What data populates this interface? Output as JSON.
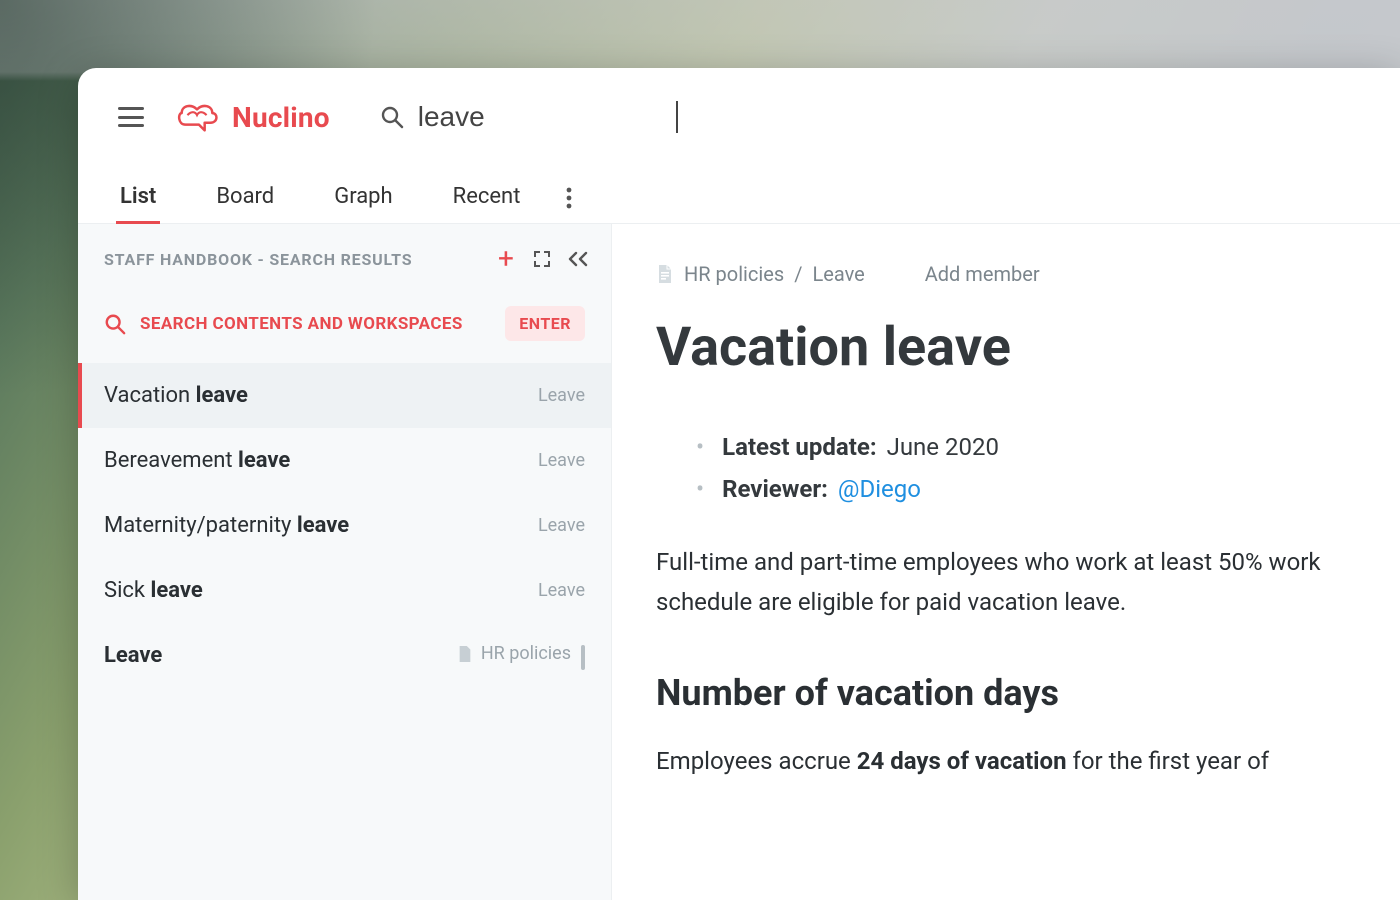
{
  "brand": {
    "name": "Nuclino"
  },
  "search": {
    "value": "leave"
  },
  "tabs": [
    "List",
    "Board",
    "Graph",
    "Recent"
  ],
  "active_tab": 0,
  "sidebar": {
    "title": "STAFF HANDBOOK - SEARCH RESULTS",
    "search_all_label": "SEARCH CONTENTS AND WORKSPACES",
    "enter_label": "ENTER",
    "results": [
      {
        "pre": "Vacation ",
        "match": "leave",
        "tag": "Leave",
        "selected": true
      },
      {
        "pre": "Bereavement ",
        "match": "leave",
        "tag": "Leave"
      },
      {
        "pre": "Maternity/paternity ",
        "match": "leave",
        "tag": "Leave"
      },
      {
        "pre": "Sick ",
        "match": "leave",
        "tag": "Leave"
      },
      {
        "pre": "",
        "match": "Leave",
        "tag_folder": "HR policies",
        "is_folder": true
      }
    ]
  },
  "doc": {
    "breadcrumbs": [
      "HR policies",
      "Leave"
    ],
    "add_member": "Add member",
    "title": "Vacation leave",
    "meta": {
      "update_key": "Latest update:",
      "update_val": "June 2020",
      "reviewer_key": "Reviewer:",
      "reviewer_val": "@Diego"
    },
    "para1": "Full-time and part-time employees who work at least 50% work schedule are eligible for paid vacation leave.",
    "h2": "Number of vacation days",
    "para2_pre": "Employees accrue ",
    "para2_bold": "24 days of vacation",
    "para2_post": " for the first year of"
  }
}
